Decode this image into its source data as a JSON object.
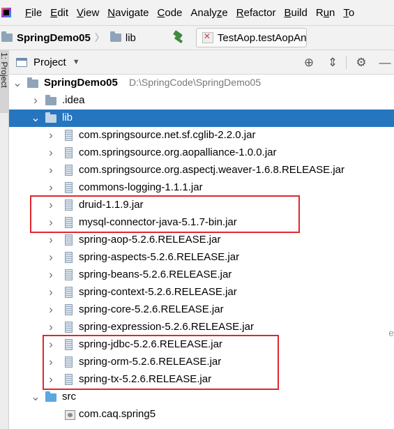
{
  "menubar": {
    "items": [
      "File",
      "Edit",
      "View",
      "Navigate",
      "Code",
      "Analyze",
      "Refactor",
      "Build",
      "Run",
      "To"
    ],
    "mnemonics": [
      "F",
      "E",
      "V",
      "N",
      "C",
      "z",
      "R",
      "B",
      "u",
      "T"
    ]
  },
  "navbar": {
    "project": "SpringDemo05",
    "separator": "〉",
    "folder": "lib",
    "run_config": "TestAop.testAopAn"
  },
  "side_strip": {
    "tab_label": "1: Project"
  },
  "panel": {
    "title": "Project",
    "caret": "▼",
    "tools": [
      "⊕",
      "⇕",
      "⚙",
      "—"
    ]
  },
  "tree": {
    "rows": [
      {
        "depth": 0,
        "expanded": true,
        "icon": "folder",
        "label": "SpringDemo05",
        "path": "D:\\SpringCode\\SpringDemo05",
        "bold": true
      },
      {
        "depth": 1,
        "expanded": false,
        "icon": "folder",
        "label": ".idea"
      },
      {
        "depth": 1,
        "expanded": true,
        "icon": "folder",
        "label": "lib",
        "selected": true
      },
      {
        "depth": 2,
        "expanded": false,
        "icon": "jar",
        "label": "com.springsource.net.sf.cglib-2.2.0.jar"
      },
      {
        "depth": 2,
        "expanded": false,
        "icon": "jar",
        "label": "com.springsource.org.aopalliance-1.0.0.jar"
      },
      {
        "depth": 2,
        "expanded": false,
        "icon": "jar",
        "label": "com.springsource.org.aspectj.weaver-1.6.8.RELEASE.jar"
      },
      {
        "depth": 2,
        "expanded": false,
        "icon": "jar",
        "label": "commons-logging-1.1.1.jar"
      },
      {
        "depth": 2,
        "expanded": false,
        "icon": "jar",
        "label": "druid-1.1.9.jar"
      },
      {
        "depth": 2,
        "expanded": false,
        "icon": "jar",
        "label": "mysql-connector-java-5.1.7-bin.jar"
      },
      {
        "depth": 2,
        "expanded": false,
        "icon": "jar",
        "label": "spring-aop-5.2.6.RELEASE.jar"
      },
      {
        "depth": 2,
        "expanded": false,
        "icon": "jar",
        "label": "spring-aspects-5.2.6.RELEASE.jar"
      },
      {
        "depth": 2,
        "expanded": false,
        "icon": "jar",
        "label": "spring-beans-5.2.6.RELEASE.jar"
      },
      {
        "depth": 2,
        "expanded": false,
        "icon": "jar",
        "label": "spring-context-5.2.6.RELEASE.jar"
      },
      {
        "depth": 2,
        "expanded": false,
        "icon": "jar",
        "label": "spring-core-5.2.6.RELEASE.jar"
      },
      {
        "depth": 2,
        "expanded": false,
        "icon": "jar",
        "label": "spring-expression-5.2.6.RELEASE.jar"
      },
      {
        "depth": 2,
        "expanded": false,
        "icon": "jar",
        "label": "spring-jdbc-5.2.6.RELEASE.jar"
      },
      {
        "depth": 2,
        "expanded": false,
        "icon": "jar",
        "label": "spring-orm-5.2.6.RELEASE.jar"
      },
      {
        "depth": 2,
        "expanded": false,
        "icon": "jar",
        "label": "spring-tx-5.2.6.RELEASE.jar"
      },
      {
        "depth": 1,
        "expanded": true,
        "icon": "folder-blue",
        "label": "src"
      },
      {
        "depth": 2,
        "expanded": null,
        "icon": "package",
        "label": "com.caq.spring5"
      }
    ]
  },
  "annotations": {
    "highlight_color": "#e0262e",
    "groups": [
      {
        "label": "druid + mysql connector",
        "first_row": 7,
        "last_row": 8
      },
      {
        "label": "spring jdbc/orm/tx",
        "first_row": 15,
        "last_row": 17
      }
    ]
  },
  "colors": {
    "selection": "#2675bf",
    "chrome": "#f2f2f2",
    "folder": "#8fa4b8",
    "source_folder": "#5aa8e0"
  }
}
